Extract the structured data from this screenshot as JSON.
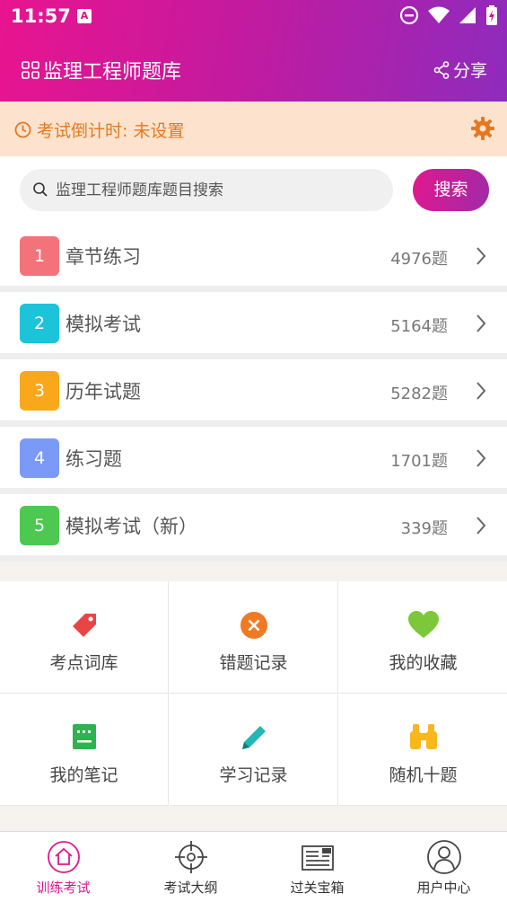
{
  "status_bar": {
    "time": "11:57",
    "notification_glyph": "A"
  },
  "header": {
    "title": "监理工程师题库",
    "share_label": "分享"
  },
  "countdown": {
    "label": "考试倒计时: 未设置"
  },
  "search": {
    "placeholder": "监理工程师题库题目搜索",
    "button_label": "搜索"
  },
  "categories": [
    {
      "index": "1",
      "name": "章节练习",
      "count": "4976题",
      "color": "#f3737a"
    },
    {
      "index": "2",
      "name": "模拟考试",
      "count": "5164题",
      "color": "#1cc3d9"
    },
    {
      "index": "3",
      "name": "历年试题",
      "count": "5282题",
      "color": "#f8a81a"
    },
    {
      "index": "4",
      "name": "练习题",
      "count": "1701题",
      "color": "#7b9af7"
    },
    {
      "index": "5",
      "name": "模拟考试（新）",
      "count": "339题",
      "color": "#4dc850"
    }
  ],
  "tools": [
    {
      "label": "考点词库",
      "icon": "tag-icon"
    },
    {
      "label": "错题记录",
      "icon": "close-circle-icon"
    },
    {
      "label": "我的收藏",
      "icon": "heart-icon"
    },
    {
      "label": "我的笔记",
      "icon": "notebook-icon"
    },
    {
      "label": "学习记录",
      "icon": "pencil-icon"
    },
    {
      "label": "随机十题",
      "icon": "binoculars-icon"
    }
  ],
  "tabs": [
    {
      "label": "训练考试",
      "icon": "home-icon",
      "active": true
    },
    {
      "label": "考试大纲",
      "icon": "target-icon",
      "active": false
    },
    {
      "label": "过关宝箱",
      "icon": "newspaper-icon",
      "active": false
    },
    {
      "label": "用户中心",
      "icon": "user-icon",
      "active": false
    }
  ],
  "colors": {
    "accent": "#e0188f",
    "warning": "#e5781f",
    "warning_bg": "#fde3cd"
  }
}
